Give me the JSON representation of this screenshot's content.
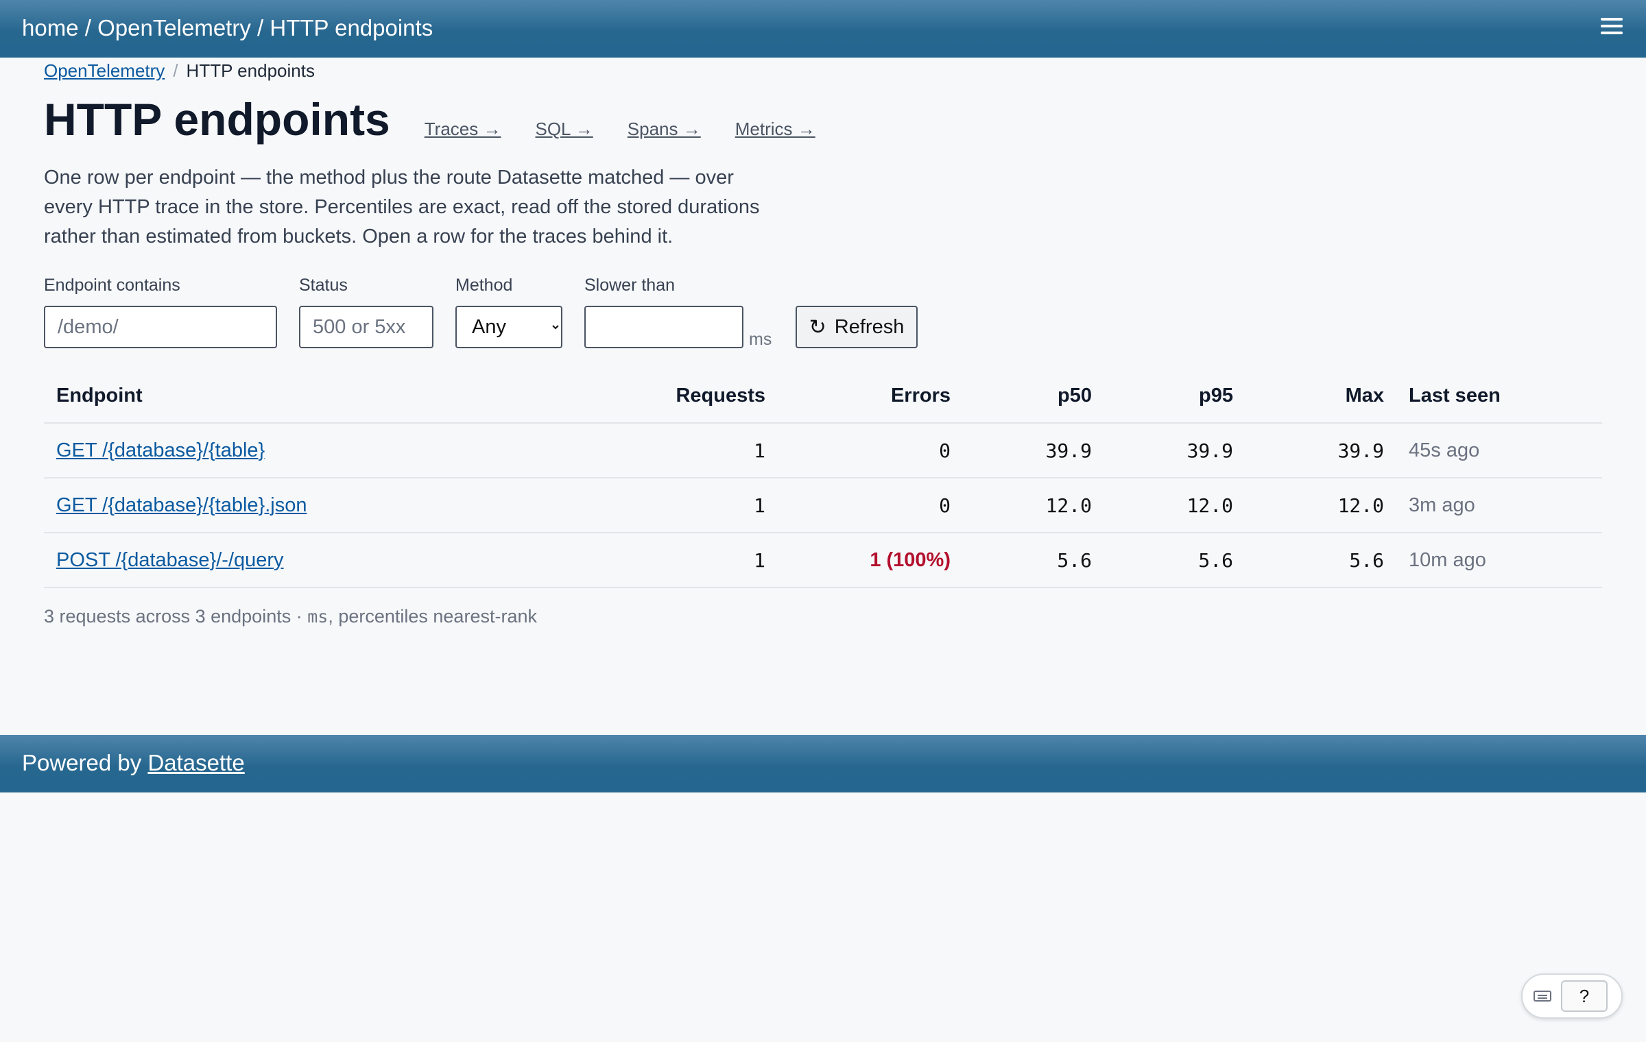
{
  "header": {
    "crumb_home": "home",
    "crumb_sep": " / ",
    "crumb_db": "OpenTelemetry",
    "crumb_page": "HTTP endpoints"
  },
  "subcrumb": {
    "link": "OpenTelemetry",
    "sep": "/",
    "current": "HTTP endpoints"
  },
  "page": {
    "title": "HTTP endpoints",
    "nav": {
      "traces": "Traces →",
      "sql": "SQL →",
      "spans": "Spans →",
      "metrics": "Metrics →"
    },
    "description": "One row per endpoint — the method plus the route Datasette matched — over every HTTP trace in the store. Percentiles are exact, read off the stored durations rather than estimated from buckets. Open a row for the traces behind it."
  },
  "filters": {
    "endpoint_label": "Endpoint contains",
    "endpoint_placeholder": "/demo/",
    "status_label": "Status",
    "status_placeholder": "500 or 5xx",
    "method_label": "Method",
    "method_selected": "Any",
    "slower_label": "Slower than",
    "slower_value": "",
    "slower_unit": "ms",
    "refresh_label": "Refresh"
  },
  "table": {
    "columns": [
      "Endpoint",
      "Requests",
      "Errors",
      "p50",
      "p95",
      "Max",
      "Last seen"
    ],
    "rows": [
      {
        "endpoint": "GET /{database}/{table}",
        "requests": "1",
        "errors": "0",
        "p50": "39.9",
        "p95": "39.9",
        "max": "39.9",
        "last_seen": "45s ago"
      },
      {
        "endpoint": "GET /{database}/{table}.json",
        "requests": "1",
        "errors": "0",
        "p50": "12.0",
        "p95": "12.0",
        "max": "12.0",
        "last_seen": "3m ago"
      },
      {
        "endpoint": "POST /{database}/-/query",
        "requests": "1",
        "errors": "1 (100%)",
        "p50": "5.6",
        "p95": "5.6",
        "max": "5.6",
        "last_seen": "10m ago"
      }
    ]
  },
  "summary": {
    "prefix": "3 requests across 3 endpoints · ",
    "unit": "ms",
    "suffix": ", percentiles nearest-rank"
  },
  "footer": {
    "prefix": "Powered by ",
    "link": "Datasette"
  },
  "widget": {
    "help_label": "?",
    "icon": "keyboard-icon"
  },
  "colors": {
    "header_bg": "#27678f",
    "link": "#0b5aa0",
    "error": "#b3102d"
  }
}
